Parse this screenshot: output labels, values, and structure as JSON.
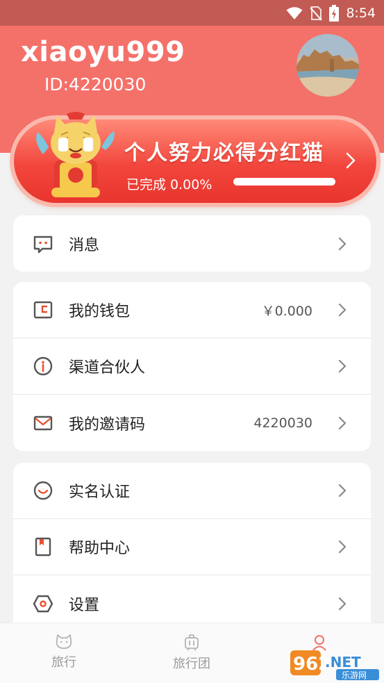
{
  "status_bar": {
    "time": "8:54"
  },
  "profile": {
    "username": "xiaoyu999",
    "id_text": "ID:4220030"
  },
  "banner": {
    "title": "个人努力必得分红猫",
    "progress_label": "已完成 0.00%",
    "progress_fraction": 0.0
  },
  "groups": [
    {
      "items": [
        {
          "label": "消息",
          "icon": "message-icon",
          "value": ""
        }
      ]
    },
    {
      "items": [
        {
          "label": "我的钱包",
          "icon": "wallet-icon",
          "value": "￥0.000"
        },
        {
          "label": "渠道合伙人",
          "icon": "info-icon",
          "value": ""
        },
        {
          "label": "我的邀请码",
          "icon": "mail-icon",
          "value": "4220030"
        }
      ]
    },
    {
      "items": [
        {
          "label": "实名认证",
          "icon": "smile-icon",
          "value": ""
        },
        {
          "label": "帮助中心",
          "icon": "book-icon",
          "value": ""
        },
        {
          "label": "设置",
          "icon": "settings-icon",
          "value": ""
        }
      ]
    }
  ],
  "tabbar": {
    "tabs": [
      {
        "label": "旅行",
        "icon": "cat-face-icon"
      },
      {
        "label": "旅行团",
        "icon": "luggage-icon"
      },
      {
        "label": "",
        "icon": "profile-icon"
      }
    ]
  },
  "watermark": {
    "text": "962.NET",
    "subtext": "乐游网"
  },
  "colors": {
    "header": "#f4716a",
    "banner_red": "#f2463d",
    "accent": "#e8502f",
    "icon_gray": "#555555"
  }
}
